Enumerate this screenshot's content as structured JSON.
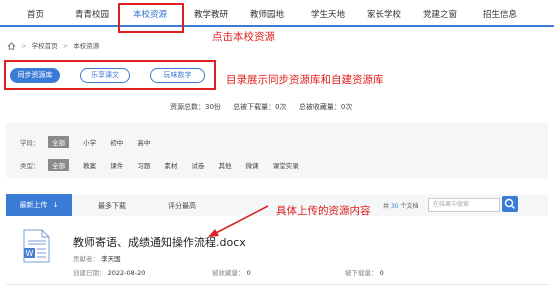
{
  "nav": {
    "items": [
      "首页",
      "青青校园",
      "本校资源",
      "教学教研",
      "教师园地",
      "学生天地",
      "家长学校",
      "党建之窗",
      "招生信息"
    ],
    "active_index": 2
  },
  "annotations": {
    "nav_note": "点击本校资源",
    "tabs_note": "目录展示同步资源库和自建资源库",
    "content_note": "具体上传的资源内容"
  },
  "breadcrumb": {
    "home": "学校首页",
    "sep": ">",
    "current": "本校资源"
  },
  "resource_tabs": [
    "同步资源库",
    "乐享课文",
    "玩味数字"
  ],
  "stats": {
    "total": "资源总数：30份",
    "downloads": "总被下载量：0次",
    "favorites": "总被收藏量：0次"
  },
  "filters": {
    "stage_label": "学段：",
    "stage_options": [
      "全部",
      "小学",
      "初中",
      "高中"
    ],
    "type_label": "类型：",
    "type_options": [
      "全部",
      "教案",
      "课件",
      "习题",
      "素材",
      "试卷",
      "其他",
      "微课",
      "课堂实录"
    ]
  },
  "sort": {
    "latest": "最新上传",
    "arrow": "↓",
    "most_download": "最多下载",
    "top_rated": "评分最高"
  },
  "result_count": {
    "prefix": "共",
    "num": "30",
    "suffix": "个文档"
  },
  "search": {
    "placeholder": "在结果中搜索"
  },
  "document": {
    "title": "教师寄语、成绩通知操作流程.docx",
    "contributor_label": "贡献者：",
    "contributor": "李天国",
    "date_label": "创建日期：",
    "date": "2022-08-20",
    "fav_label": "被收藏量：",
    "fav": "0",
    "down_label": "被下载量：",
    "down": "0"
  },
  "colors": {
    "accent": "#3a7bd5",
    "annotation": "#e02020"
  }
}
